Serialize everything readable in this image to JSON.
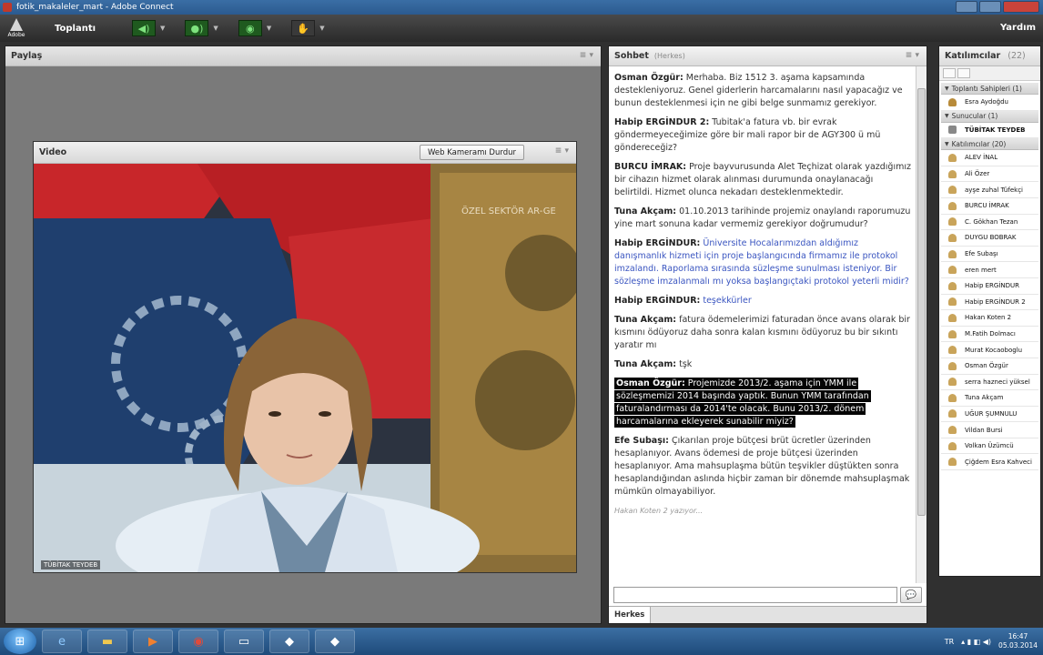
{
  "window": {
    "title": "fotik_makaleler_mart - Adobe Connect"
  },
  "menubar": {
    "logo_text": "Adobe",
    "meeting_menu": "Toplantı",
    "help": "Yardım"
  },
  "share_pod": {
    "title": "Paylaş"
  },
  "video_pod": {
    "title": "Video",
    "stop_camera_button": "Web Kameramı Durdur",
    "camera_label": "TÜBİTAK TEYDEB",
    "banner_text": "ÖZEL SEKTÖR AR-GE"
  },
  "chat_pod": {
    "title": "Sohbet",
    "scope": "(Herkes)",
    "messages": [
      {
        "who": "Osman Özgür:",
        "text": "Merhaba. Biz 1512 3. aşama kapsamında destekleniyoruz. Genel giderlerin harcamalarını nasıl yapacağız ve bunun desteklenmesi için ne gibi belge sunmamız gerekiyor."
      },
      {
        "who": "Habip ERGİNDUR 2:",
        "text": "Tubitak'a fatura vb. bir evrak göndermeyeceğimize göre bir mali rapor bir de AGY300 ü mü göndereceğiz?"
      },
      {
        "who": "BURCU İMRAK:",
        "text": "Proje bayvurusunda Alet Teçhizat olarak yazdığımız bir cihazın hizmet olarak alınması durumunda onaylanacağı belirtildi. Hizmet olunca nekadarı desteklenmektedir."
      },
      {
        "who": "Tuna Akçam:",
        "text": "01.10.2013 tarihinde projemiz onaylandı raporumuzu yine mart sonuna kadar vermemiz gerekiyor doğrumudur?"
      },
      {
        "who": "Habip ERGİNDUR:",
        "text": "Üniversite Hocalarımızdan aldığımız danışmanlık hizmeti için proje başlangıcında firmamız ile protokol imzalandı. Raporlama sırasında süzleşme sunulması isteniyor. Bir sözleşme imzalanmalı mı yoksa başlangıçtaki protokol yeterli midir?"
      },
      {
        "who": "Habip ERGİNDUR:",
        "text": "teşekkürler"
      },
      {
        "who": "Tuna Akçam:",
        "text": "fatura ödemelerimizi faturadan önce avans olarak bir kısmını ödüyoruz daha sonra kalan kısmını ödüyoruz bu bir sıkıntı yaratır mı"
      },
      {
        "who": "Tuna Akçam:",
        "text": "tşk"
      },
      {
        "who": "Osman Özgür:",
        "text": "Projemizde 2013/2. aşama için YMM ile sözleşmemizi 2014 başında yaptık. Bunun YMM tarafından faturalandırması da 2014'te olacak. Bunu 2013/2. dönem harcamalarına ekleyerek sunabilir miyiz?"
      },
      {
        "who": "Efe  Subaşı:",
        "text": "Çıkarılan proje bütçesi brüt ücretler üzerinden hesaplanıyor. Avans ödemesi de proje bütçesi üzerinden hesaplanıyor. Ama mahsuplaşma bütün teşvikler düştükten sonra hesaplandığından aslında hiçbir zaman bir dönemde mahsuplaşmak mümkün olmayabiliyor."
      }
    ],
    "typing_indicator": "Hakan Koten 2 yazıyor...",
    "footer_tab": "Herkes"
  },
  "attendees_pod": {
    "title": "Katılımcılar",
    "count": "(22)",
    "groups": [
      {
        "label": "Toplantı Sahipleri (1)",
        "members": [
          "Esra Aydoğdu"
        ]
      },
      {
        "label": "Sunucular (1)",
        "members": [
          "TÜBİTAK TEYDEB"
        ]
      },
      {
        "label": "Katılımcılar (20)",
        "members": [
          "ALEV İNAL",
          "Ali Özer",
          "ayşe zuhal Tüfekçi",
          "BURCU İMRAK",
          "C. Gökhan  Tezan",
          "DUYGU BOBRAK",
          "Efe  Subaşı",
          "eren mert",
          "Habip ERGİNDUR",
          "Habip ERGİNDUR 2",
          "Hakan Koten 2",
          "M.Fatih Dolmacı",
          "Murat Kocaoboglu",
          "Osman Özgür",
          "serra hazneci yüksel",
          "Tuna Akçam",
          "UĞUR ŞUMNULU",
          "Vildan Bursi",
          "Volkan  Üzümcü",
          "Çiğdem Esra Kahveci"
        ]
      }
    ]
  },
  "taskbar": {
    "lang": "TR",
    "time": "16:47",
    "date": "05.03.2014"
  }
}
